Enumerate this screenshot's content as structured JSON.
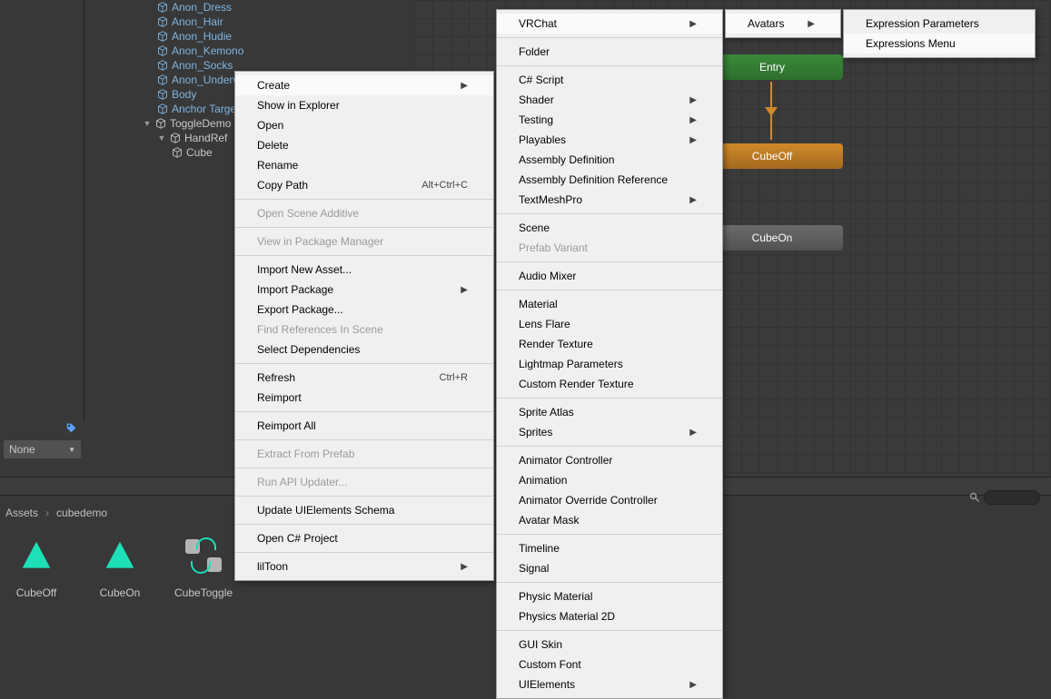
{
  "hierarchy": {
    "items": [
      "Anon_Dress",
      "Anon_Hair",
      "Anon_Hudie",
      "Anon_Kemono",
      "Anon_Socks",
      "Anon_Underwear",
      "Body",
      "Anchor Target"
    ],
    "toggleDemo": "ToggleDemo",
    "handRef": "HandRef",
    "cube": "Cube"
  },
  "tagDropdown": {
    "value": "None"
  },
  "breadcrumb": {
    "root": "Assets",
    "folder": "cubedemo"
  },
  "assets": [
    {
      "label": "CubeOff",
      "kind": "anim"
    },
    {
      "label": "CubeOn",
      "kind": "anim"
    },
    {
      "label": "CubeToggle",
      "kind": "toggle"
    }
  ],
  "graph": {
    "entry": "Entry",
    "cubeoff": "CubeOff",
    "cubeon": "CubeOn"
  },
  "menu_main": [
    {
      "label": "Create",
      "sub": true,
      "hl": true
    },
    {
      "label": "Show in Explorer"
    },
    {
      "label": "Open"
    },
    {
      "label": "Delete"
    },
    {
      "label": "Rename"
    },
    {
      "label": "Copy Path",
      "shortcut": "Alt+Ctrl+C"
    },
    {
      "sep": true
    },
    {
      "label": "Open Scene Additive",
      "disabled": true
    },
    {
      "sep": true
    },
    {
      "label": "View in Package Manager",
      "disabled": true
    },
    {
      "sep": true
    },
    {
      "label": "Import New Asset..."
    },
    {
      "label": "Import Package",
      "sub": true
    },
    {
      "label": "Export Package..."
    },
    {
      "label": "Find References In Scene",
      "disabled": true
    },
    {
      "label": "Select Dependencies"
    },
    {
      "sep": true
    },
    {
      "label": "Refresh",
      "shortcut": "Ctrl+R"
    },
    {
      "label": "Reimport"
    },
    {
      "sep": true
    },
    {
      "label": "Reimport All"
    },
    {
      "sep": true
    },
    {
      "label": "Extract From Prefab",
      "disabled": true
    },
    {
      "sep": true
    },
    {
      "label": "Run API Updater...",
      "disabled": true
    },
    {
      "sep": true
    },
    {
      "label": "Update UIElements Schema"
    },
    {
      "sep": true
    },
    {
      "label": "Open C# Project"
    },
    {
      "sep": true
    },
    {
      "label": "lilToon",
      "sub": true
    }
  ],
  "menu_create": [
    {
      "label": "VRChat",
      "sub": true,
      "hl": true
    },
    {
      "sep": true
    },
    {
      "label": "Folder"
    },
    {
      "sep": true
    },
    {
      "label": "C# Script"
    },
    {
      "label": "Shader",
      "sub": true
    },
    {
      "label": "Testing",
      "sub": true
    },
    {
      "label": "Playables",
      "sub": true
    },
    {
      "label": "Assembly Definition"
    },
    {
      "label": "Assembly Definition Reference"
    },
    {
      "label": "TextMeshPro",
      "sub": true
    },
    {
      "sep": true
    },
    {
      "label": "Scene"
    },
    {
      "label": "Prefab Variant",
      "disabled": true
    },
    {
      "sep": true
    },
    {
      "label": "Audio Mixer"
    },
    {
      "sep": true
    },
    {
      "label": "Material"
    },
    {
      "label": "Lens Flare"
    },
    {
      "label": "Render Texture"
    },
    {
      "label": "Lightmap Parameters"
    },
    {
      "label": "Custom Render Texture"
    },
    {
      "sep": true
    },
    {
      "label": "Sprite Atlas"
    },
    {
      "label": "Sprites",
      "sub": true
    },
    {
      "sep": true
    },
    {
      "label": "Animator Controller"
    },
    {
      "label": "Animation"
    },
    {
      "label": "Animator Override Controller"
    },
    {
      "label": "Avatar Mask"
    },
    {
      "sep": true
    },
    {
      "label": "Timeline"
    },
    {
      "label": "Signal"
    },
    {
      "sep": true
    },
    {
      "label": "Physic Material"
    },
    {
      "label": "Physics Material 2D"
    },
    {
      "sep": true
    },
    {
      "label": "GUI Skin"
    },
    {
      "label": "Custom Font"
    },
    {
      "label": "UIElements",
      "sub": true
    }
  ],
  "menu_vrchat": [
    {
      "label": "Avatars",
      "sub": true,
      "hl": true
    }
  ],
  "menu_avatars": [
    {
      "label": "Expression Parameters"
    },
    {
      "label": "Expressions Menu",
      "hl": true
    }
  ]
}
